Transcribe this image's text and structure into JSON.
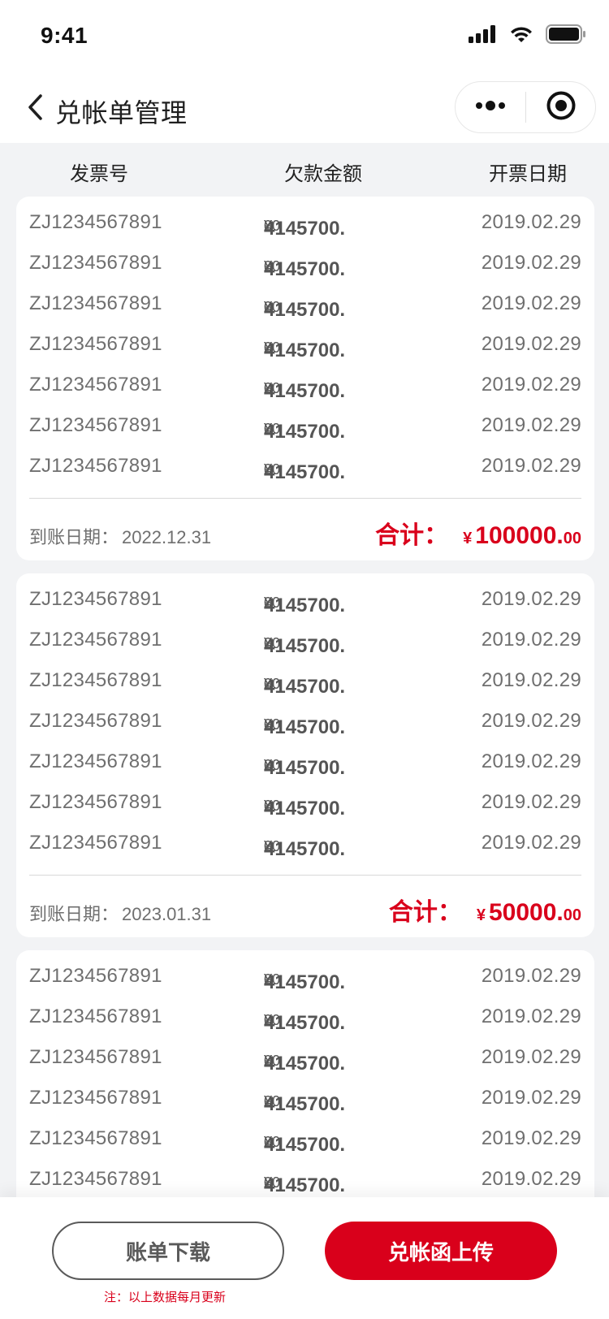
{
  "status": {
    "time": "9:41"
  },
  "nav": {
    "title": "兑帐单管理"
  },
  "columns": {
    "invoice": "发票号",
    "amount": "欠款金额",
    "date": "开票日期"
  },
  "groups": [
    {
      "rows": [
        {
          "invoice": "ZJ1234567891",
          "currency": "¥",
          "amount_int": "4145700.",
          "amount_dec": "00",
          "date": "2019.02.29"
        },
        {
          "invoice": "ZJ1234567891",
          "currency": "¥",
          "amount_int": "4145700.",
          "amount_dec": "00",
          "date": "2019.02.29"
        },
        {
          "invoice": "ZJ1234567891",
          "currency": "¥",
          "amount_int": "4145700.",
          "amount_dec": "00",
          "date": "2019.02.29"
        },
        {
          "invoice": "ZJ1234567891",
          "currency": "¥",
          "amount_int": "4145700.",
          "amount_dec": "00",
          "date": "2019.02.29"
        },
        {
          "invoice": "ZJ1234567891",
          "currency": "¥",
          "amount_int": "4145700.",
          "amount_dec": "00",
          "date": "2019.02.29"
        },
        {
          "invoice": "ZJ1234567891",
          "currency": "¥",
          "amount_int": "4145700.",
          "amount_dec": "00",
          "date": "2019.02.29"
        },
        {
          "invoice": "ZJ1234567891",
          "currency": "¥",
          "amount_int": "4145700.",
          "amount_dec": "00",
          "date": "2019.02.29"
        }
      ],
      "arrival_label": "到账日期：",
      "arrival_date": "2022.12.31",
      "total_label": "合计：",
      "total_currency": "¥",
      "total_int": "100000.",
      "total_dec": "00"
    },
    {
      "rows": [
        {
          "invoice": "ZJ1234567891",
          "currency": "¥",
          "amount_int": "4145700.",
          "amount_dec": "00",
          "date": "2019.02.29"
        },
        {
          "invoice": "ZJ1234567891",
          "currency": "¥",
          "amount_int": "4145700.",
          "amount_dec": "00",
          "date": "2019.02.29"
        },
        {
          "invoice": "ZJ1234567891",
          "currency": "¥",
          "amount_int": "4145700.",
          "amount_dec": "00",
          "date": "2019.02.29"
        },
        {
          "invoice": "ZJ1234567891",
          "currency": "¥",
          "amount_int": "4145700.",
          "amount_dec": "00",
          "date": "2019.02.29"
        },
        {
          "invoice": "ZJ1234567891",
          "currency": "¥",
          "amount_int": "4145700.",
          "amount_dec": "00",
          "date": "2019.02.29"
        },
        {
          "invoice": "ZJ1234567891",
          "currency": "¥",
          "amount_int": "4145700.",
          "amount_dec": "00",
          "date": "2019.02.29"
        },
        {
          "invoice": "ZJ1234567891",
          "currency": "¥",
          "amount_int": "4145700.",
          "amount_dec": "00",
          "date": "2019.02.29"
        }
      ],
      "arrival_label": "到账日期：",
      "arrival_date": "2023.01.31",
      "total_label": "合计：",
      "total_currency": "¥",
      "total_int": "50000.",
      "total_dec": "00"
    },
    {
      "rows": [
        {
          "invoice": "ZJ1234567891",
          "currency": "¥",
          "amount_int": "4145700.",
          "amount_dec": "00",
          "date": "2019.02.29"
        },
        {
          "invoice": "ZJ1234567891",
          "currency": "¥",
          "amount_int": "4145700.",
          "amount_dec": "00",
          "date": "2019.02.29"
        },
        {
          "invoice": "ZJ1234567891",
          "currency": "¥",
          "amount_int": "4145700.",
          "amount_dec": "00",
          "date": "2019.02.29"
        },
        {
          "invoice": "ZJ1234567891",
          "currency": "¥",
          "amount_int": "4145700.",
          "amount_dec": "00",
          "date": "2019.02.29"
        },
        {
          "invoice": "ZJ1234567891",
          "currency": "¥",
          "amount_int": "4145700.",
          "amount_dec": "00",
          "date": "2019.02.29"
        },
        {
          "invoice": "ZJ1234567891",
          "currency": "¥",
          "amount_int": "4145700.",
          "amount_dec": "00",
          "date": "2019.02.29"
        }
      ]
    }
  ],
  "buttons": {
    "download": "账单下载",
    "upload": "兑帐函上传"
  },
  "note": "注：以上数据每月更新",
  "colors": {
    "accent": "#d9001b",
    "background": "#f2f3f5",
    "card": "#ffffff"
  },
  "icons": [
    "signal-icon",
    "wifi-icon",
    "battery-icon",
    "back-chevron-icon",
    "more-dots-icon",
    "capsule-close-icon"
  ]
}
